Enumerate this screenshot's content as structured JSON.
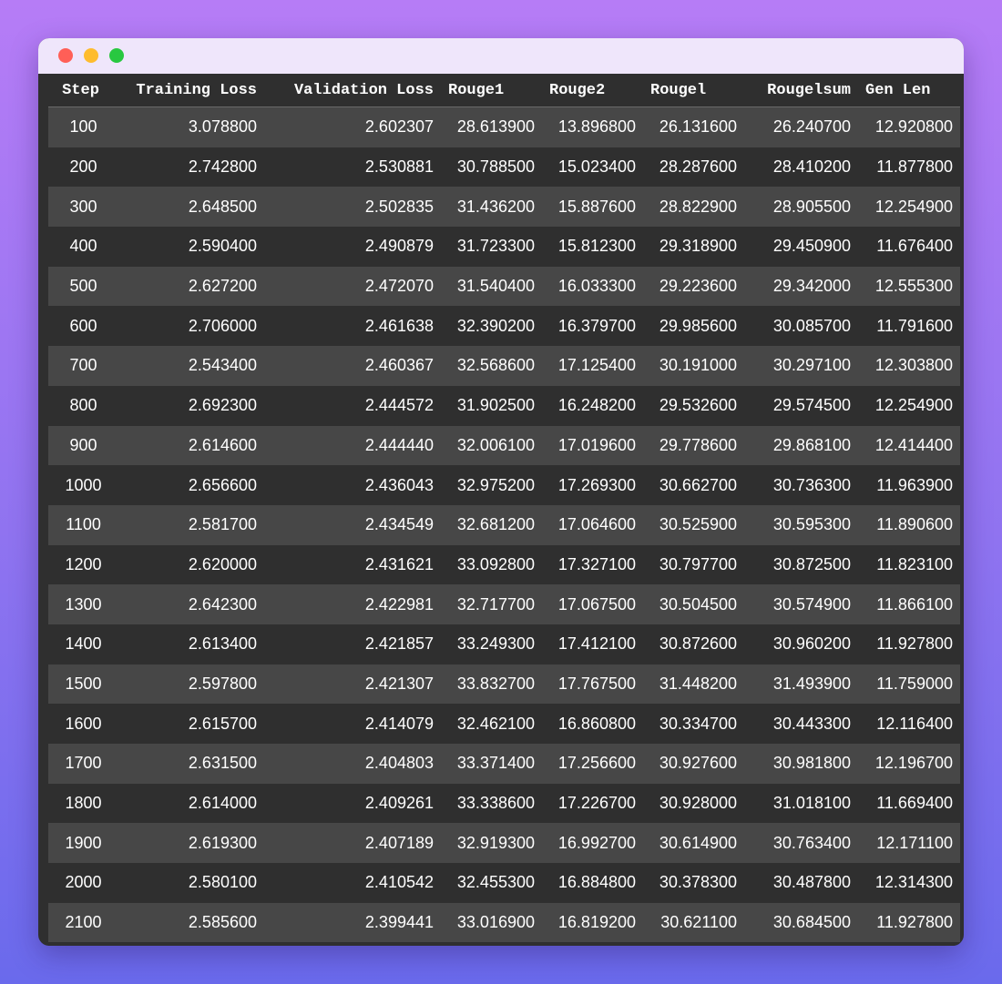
{
  "window": {
    "controls": [
      "close",
      "minimize",
      "maximize"
    ]
  },
  "table": {
    "columns": [
      "Step",
      "Training Loss",
      "Validation Loss",
      "Rouge1",
      "Rouge2",
      "Rougel",
      "Rougelsum",
      "Gen Len"
    ],
    "rows": [
      [
        "100",
        "3.078800",
        "2.602307",
        "28.613900",
        "13.896800",
        "26.131600",
        "26.240700",
        "12.920800"
      ],
      [
        "200",
        "2.742800",
        "2.530881",
        "30.788500",
        "15.023400",
        "28.287600",
        "28.410200",
        "11.877800"
      ],
      [
        "300",
        "2.648500",
        "2.502835",
        "31.436200",
        "15.887600",
        "28.822900",
        "28.905500",
        "12.254900"
      ],
      [
        "400",
        "2.590400",
        "2.490879",
        "31.723300",
        "15.812300",
        "29.318900",
        "29.450900",
        "11.676400"
      ],
      [
        "500",
        "2.627200",
        "2.472070",
        "31.540400",
        "16.033300",
        "29.223600",
        "29.342000",
        "12.555300"
      ],
      [
        "600",
        "2.706000",
        "2.461638",
        "32.390200",
        "16.379700",
        "29.985600",
        "30.085700",
        "11.791600"
      ],
      [
        "700",
        "2.543400",
        "2.460367",
        "32.568600",
        "17.125400",
        "30.191000",
        "30.297100",
        "12.303800"
      ],
      [
        "800",
        "2.692300",
        "2.444572",
        "31.902500",
        "16.248200",
        "29.532600",
        "29.574500",
        "12.254900"
      ],
      [
        "900",
        "2.614600",
        "2.444440",
        "32.006100",
        "17.019600",
        "29.778600",
        "29.868100",
        "12.414400"
      ],
      [
        "1000",
        "2.656600",
        "2.436043",
        "32.975200",
        "17.269300",
        "30.662700",
        "30.736300",
        "11.963900"
      ],
      [
        "1100",
        "2.581700",
        "2.434549",
        "32.681200",
        "17.064600",
        "30.525900",
        "30.595300",
        "11.890600"
      ],
      [
        "1200",
        "2.620000",
        "2.431621",
        "33.092800",
        "17.327100",
        "30.797700",
        "30.872500",
        "11.823100"
      ],
      [
        "1300",
        "2.642300",
        "2.422981",
        "32.717700",
        "17.067500",
        "30.504500",
        "30.574900",
        "11.866100"
      ],
      [
        "1400",
        "2.613400",
        "2.421857",
        "33.249300",
        "17.412100",
        "30.872600",
        "30.960200",
        "11.927800"
      ],
      [
        "1500",
        "2.597800",
        "2.421307",
        "33.832700",
        "17.767500",
        "31.448200",
        "31.493900",
        "11.759000"
      ],
      [
        "1600",
        "2.615700",
        "2.414079",
        "32.462100",
        "16.860800",
        "30.334700",
        "30.443300",
        "12.116400"
      ],
      [
        "1700",
        "2.631500",
        "2.404803",
        "33.371400",
        "17.256600",
        "30.927600",
        "30.981800",
        "12.196700"
      ],
      [
        "1800",
        "2.614000",
        "2.409261",
        "33.338600",
        "17.226700",
        "30.928000",
        "31.018100",
        "11.669400"
      ],
      [
        "1900",
        "2.619300",
        "2.407189",
        "32.919300",
        "16.992700",
        "30.614900",
        "30.763400",
        "12.171100"
      ],
      [
        "2000",
        "2.580100",
        "2.410542",
        "32.455300",
        "16.884800",
        "30.378300",
        "30.487800",
        "12.314300"
      ],
      [
        "2100",
        "2.585600",
        "2.399441",
        "33.016900",
        "16.819200",
        "30.621100",
        "30.684500",
        "11.927800"
      ]
    ]
  }
}
